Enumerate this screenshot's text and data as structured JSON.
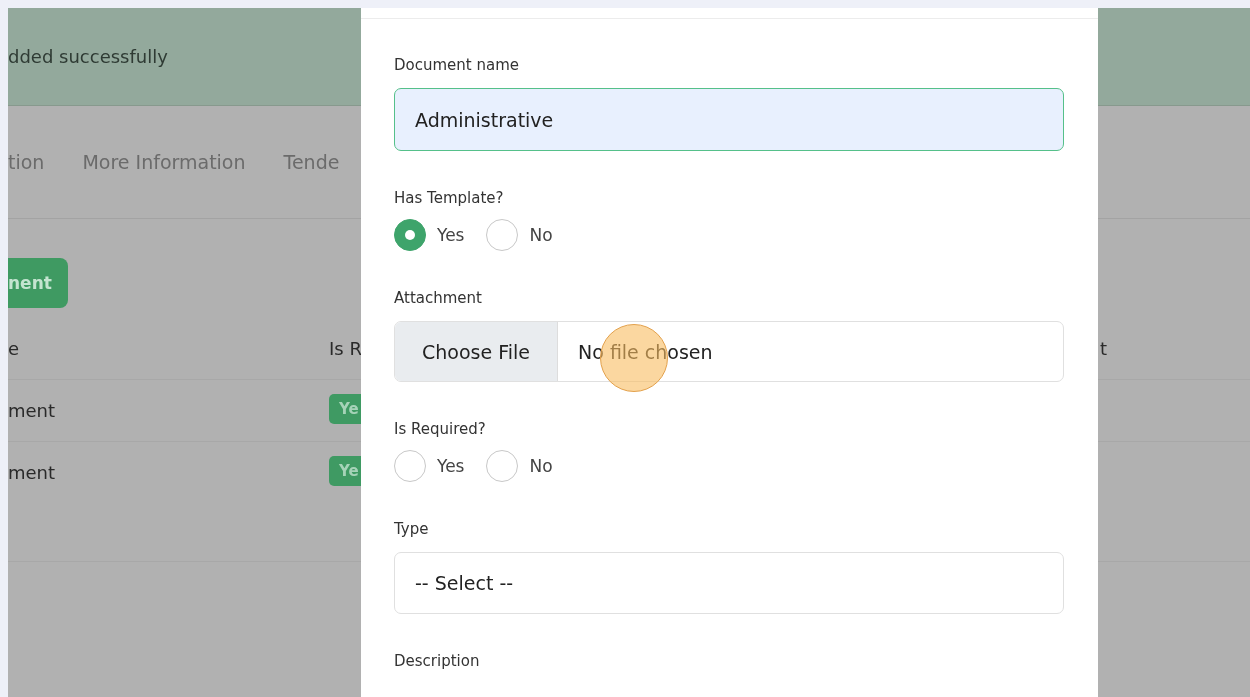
{
  "alert": {
    "message": "dded successfully"
  },
  "tabs": [
    {
      "label": "tion",
      "selected": false
    },
    {
      "label": "More Information",
      "selected": false
    },
    {
      "label": "Tende",
      "selected": false
    }
  ],
  "add_button": {
    "label": "nent"
  },
  "table": {
    "columns": [
      "e",
      "Is R",
      "t"
    ],
    "rows": [
      {
        "cells": [
          "ment",
          "Ye"
        ]
      },
      {
        "cells": [
          "ment",
          "Ye"
        ]
      }
    ]
  },
  "modal": {
    "fields": [
      {
        "kind": "text",
        "label": "Document name",
        "value": "Administrative"
      },
      {
        "kind": "radio",
        "label": "Has Template?",
        "options": [
          {
            "label": "Yes",
            "selected": true
          },
          {
            "label": "No",
            "selected": false
          }
        ]
      },
      {
        "kind": "file",
        "label": "Attachment",
        "button": "Choose File",
        "status": "No file chosen"
      },
      {
        "kind": "radio",
        "label": "Is Required?",
        "options": [
          {
            "label": "Yes",
            "selected": false
          },
          {
            "label": "No",
            "selected": false
          }
        ]
      },
      {
        "kind": "select",
        "label": "Type",
        "value": "-- Select --"
      },
      {
        "kind": "textarea",
        "label": "Description"
      }
    ]
  }
}
